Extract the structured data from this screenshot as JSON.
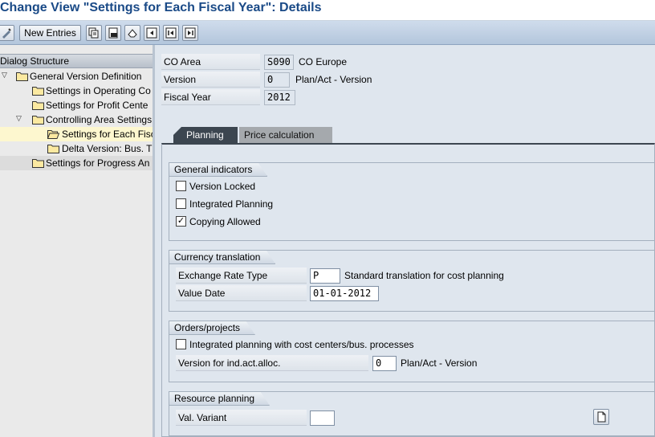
{
  "window": {
    "title": "Change View \"Settings for Each Fiscal Year\": Details"
  },
  "toolbar": {
    "new_entries_label": "New Entries",
    "icons": [
      "display-change-icon",
      "copy-icon",
      "delete-icon",
      "undo-icon",
      "select-all-icon",
      "previous-entry-icon",
      "next-entry-icon",
      "variable-list-icon"
    ]
  },
  "dialog_structure": {
    "header": "Dialog Structure",
    "items": [
      {
        "label": "General Version Definition",
        "expanded": true
      },
      {
        "label": "Settings in Operating Co"
      },
      {
        "label": "Settings for Profit Cente"
      },
      {
        "label": "Controlling Area Settings",
        "expanded": true
      },
      {
        "label": "Settings for Each Fisc",
        "selected": true
      },
      {
        "label": "Delta Version: Bus. T"
      },
      {
        "label": "Settings for Progress An"
      }
    ]
  },
  "header_fields": {
    "co_area": {
      "label": "CO Area",
      "value": "S090",
      "text": "CO Europe"
    },
    "version": {
      "label": "Version",
      "value": "0",
      "text": "Plan/Act - Version"
    },
    "fiscal_year": {
      "label": "Fiscal Year",
      "value": "2012"
    }
  },
  "tabs": [
    {
      "label": "Planning",
      "active": true
    },
    {
      "label": "Price calculation",
      "active": false
    }
  ],
  "general_indicators": {
    "title": "General indicators",
    "checkboxes": [
      {
        "label": "Version Locked",
        "checked": false
      },
      {
        "label": "Integrated Planning",
        "checked": false
      },
      {
        "label": "Copying Allowed",
        "checked": true
      }
    ]
  },
  "currency_translation": {
    "title": "Currency translation",
    "exchange_rate_type": {
      "label": "Exchange Rate Type",
      "value": "P",
      "text": "Standard translation for cost planning"
    },
    "value_date": {
      "label": "Value Date",
      "value": "01-01-2012"
    }
  },
  "orders_projects": {
    "title": "Orders/projects",
    "checkbox": {
      "label": "Integrated planning with cost centers/bus. processes",
      "checked": false
    },
    "version_ind_act_alloc": {
      "label": "Version for ind.act.alloc.",
      "value": "0",
      "text": "Plan/Act - Version"
    }
  },
  "resource_planning": {
    "title": "Resource planning",
    "val_variant": {
      "label": "Val. Variant",
      "value": ""
    }
  },
  "colors": {
    "title_blue": "#1a4a87",
    "tab_active": "#3c4650",
    "selected_row": "#fdf7cf"
  }
}
